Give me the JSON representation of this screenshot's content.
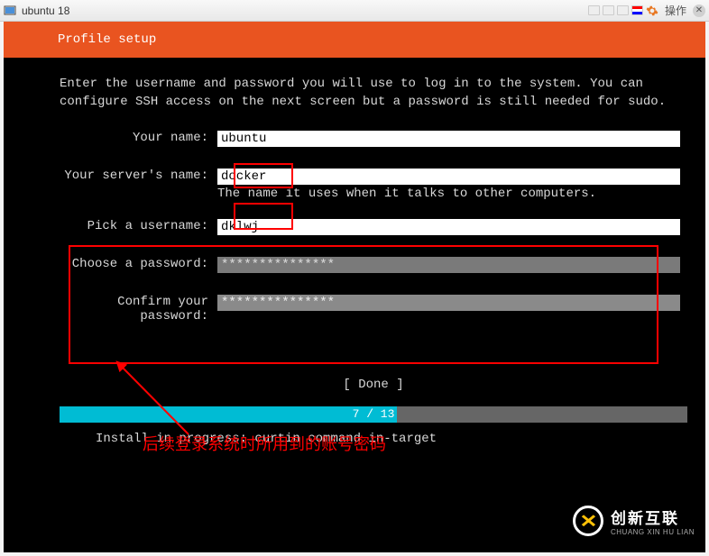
{
  "window": {
    "title": "ubuntu 18",
    "action_label": "操作"
  },
  "header": "Profile setup",
  "description": "Enter the username and password you will use to log in to the system. You can configure SSH access on the next screen but a password is still needed for sudo.",
  "form": {
    "name_label": "Your name:",
    "name_value": "ubuntu",
    "server_label": "Your server's name:",
    "server_value": "docker",
    "server_helper": "The name it uses when it talks to other computers.",
    "username_label": "Pick a username:",
    "username_value": "dklwj",
    "password_label": "Choose a password:",
    "password_masked": "***************",
    "confirm_label": "Confirm your password:",
    "confirm_masked": "***************"
  },
  "annotation": "后续登录系统时所用到的账号密码",
  "done_button": "[ Done       ]",
  "progress": {
    "label": "7 / 13",
    "percent": 53.8
  },
  "status": "Install in progress: curtin command in-target",
  "watermark": {
    "cn": "创新互联",
    "en": "CHUANG XIN HU LIAN"
  }
}
